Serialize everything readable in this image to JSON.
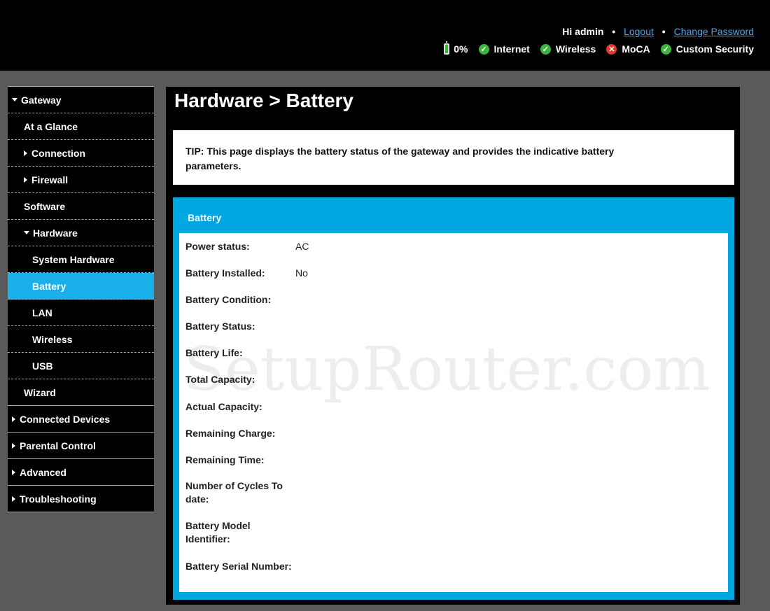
{
  "header": {
    "greeting": "Hi admin",
    "logout_label": "Logout",
    "change_password_label": "Change Password",
    "status": {
      "battery": "0%",
      "internet": "Internet",
      "wireless": "Wireless",
      "moca": "MoCA",
      "security": "Custom Security"
    }
  },
  "sidebar": {
    "items": [
      {
        "label": "Gateway",
        "level": 1,
        "icon": "chevron-down-icon"
      },
      {
        "label": "At a Glance",
        "level": 2
      },
      {
        "label": "Connection",
        "level": 2,
        "icon": "chevron-right-icon"
      },
      {
        "label": "Firewall",
        "level": 2,
        "icon": "chevron-right-icon"
      },
      {
        "label": "Software",
        "level": 2
      },
      {
        "label": "Hardware",
        "level": 2,
        "icon": "chevron-down-icon"
      },
      {
        "label": "System Hardware",
        "level": 3
      },
      {
        "label": "Battery",
        "level": 3,
        "active": true
      },
      {
        "label": "LAN",
        "level": 3
      },
      {
        "label": "Wireless",
        "level": 3
      },
      {
        "label": "USB",
        "level": 3
      },
      {
        "label": "Wizard",
        "level": 2
      },
      {
        "label": "Connected Devices",
        "level": 1,
        "icon": "chevron-right-icon"
      },
      {
        "label": "Parental Control",
        "level": 1,
        "icon": "chevron-right-icon"
      },
      {
        "label": "Advanced",
        "level": 1,
        "icon": "chevron-right-icon"
      },
      {
        "label": "Troubleshooting",
        "level": 1,
        "icon": "chevron-right-icon"
      }
    ]
  },
  "main": {
    "title": "Hardware > Battery",
    "tip": "TIP: This page displays the battery status of the gateway and provides the indicative battery parameters.",
    "panel_title": "Battery",
    "fields": [
      {
        "label": "Power status:",
        "value": "AC"
      },
      {
        "label": "Battery Installed:",
        "value": "No"
      },
      {
        "label": "Battery Condition:",
        "value": ""
      },
      {
        "label": "Battery Status:",
        "value": ""
      },
      {
        "label": "Battery Life:",
        "value": ""
      },
      {
        "label": "Total Capacity:",
        "value": ""
      },
      {
        "label": "Actual Capacity:",
        "value": ""
      },
      {
        "label": "Remaining Charge:",
        "value": ""
      },
      {
        "label": "Remaining Time:",
        "value": ""
      },
      {
        "label": "Number of Cycles To date:",
        "value": ""
      },
      {
        "label": "Battery Model Identifier:",
        "value": ""
      },
      {
        "label": "Battery Serial Number:",
        "value": ""
      }
    ]
  },
  "watermark": "SetupRouter.com",
  "colors": {
    "accent": "#00a7e1",
    "active_nav": "#1ab0ec",
    "ok": "#3cb43c",
    "error": "#e03a2c"
  }
}
